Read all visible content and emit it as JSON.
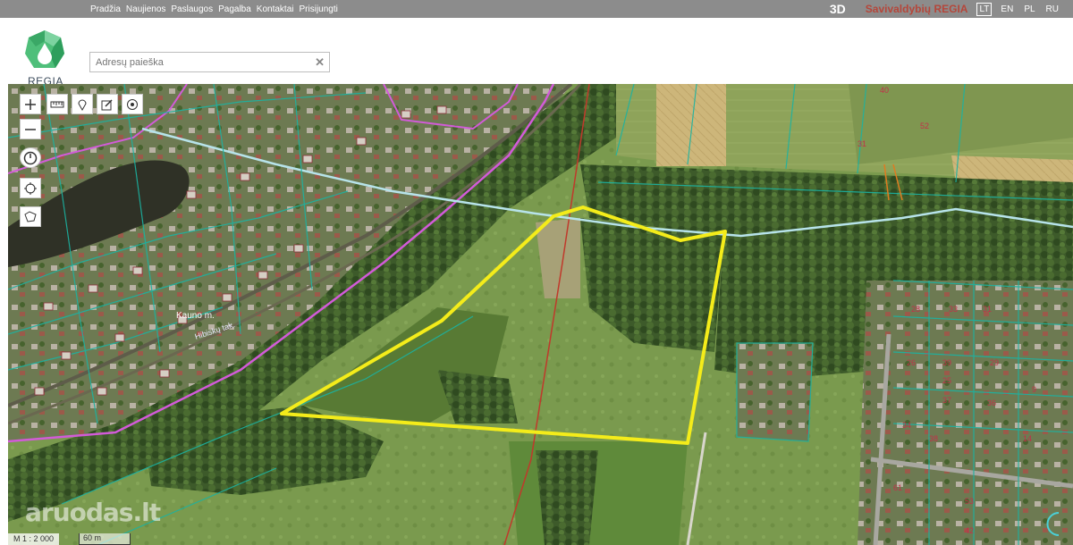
{
  "nav": {
    "items": [
      "Pradžia",
      "Naujienos",
      "Paslaugos",
      "Pagalba",
      "Kontaktai",
      "Prisijungti"
    ]
  },
  "header": {
    "mode_3d": "3D",
    "brand": "Savivaldybių REGIA",
    "languages": [
      "LT",
      "EN",
      "PL",
      "RU"
    ],
    "active_language": "LT",
    "logo_text": "REGIA"
  },
  "search": {
    "placeholder": "Adresų paieška",
    "value": ""
  },
  "map": {
    "labels": {
      "street1": "Kauno m.",
      "street2": "Hibiskų tak."
    },
    "parcel_numbers": [
      "28",
      "33",
      "31",
      "26",
      "39",
      "25",
      "37",
      "29",
      "14",
      "36",
      "31",
      "40",
      "52",
      "61",
      "53",
      "9",
      "42",
      "34",
      "38"
    ],
    "scale_ratio": "M 1 : 2 000",
    "scale_bar": "60 m",
    "colors": {
      "highlight_parcel": "#f4ec1a",
      "parcel_lines": "#1bb3a2",
      "boundary_pink": "#d25bd8",
      "road_red": "#c0392b"
    }
  },
  "watermark": "aruodas.lt",
  "tools": [
    "zoom-in",
    "zoom-out",
    "measure",
    "marker",
    "edit",
    "location",
    "history",
    "target",
    "area-select"
  ]
}
